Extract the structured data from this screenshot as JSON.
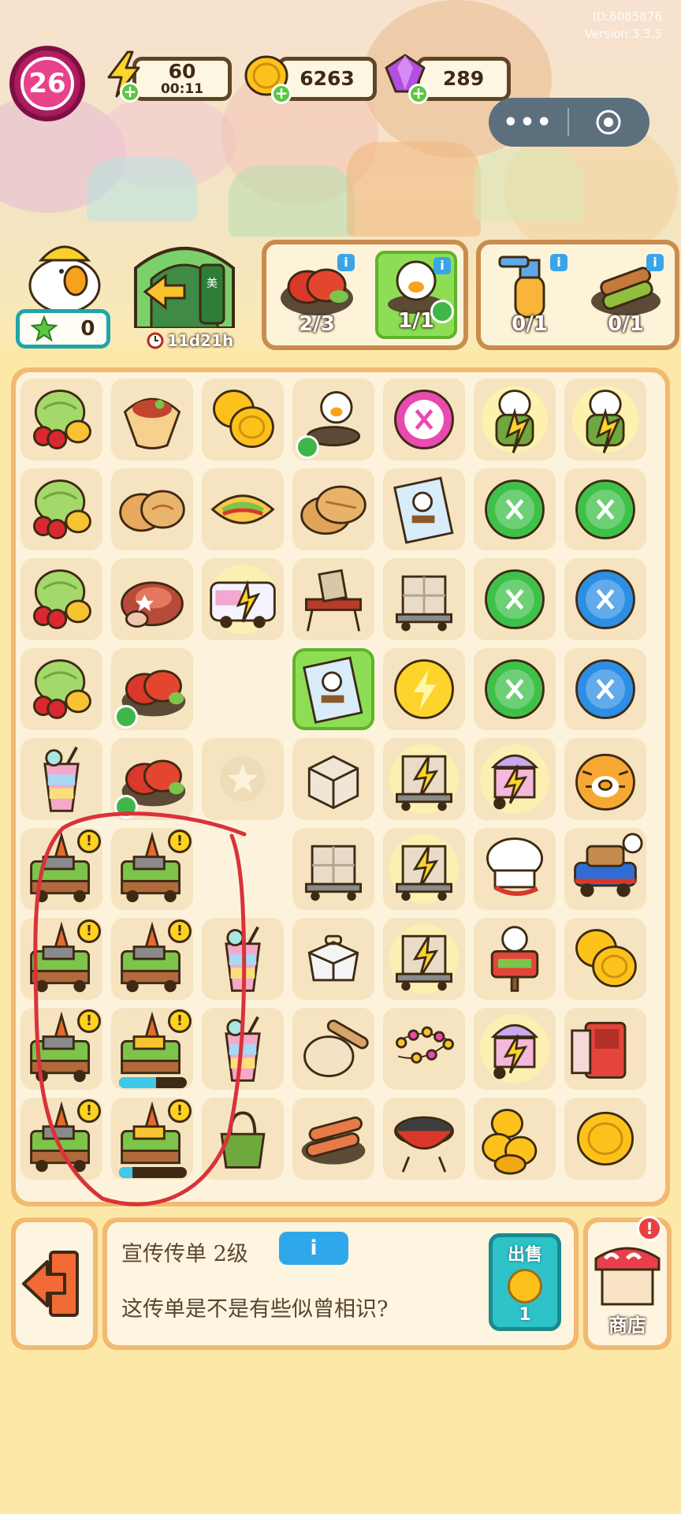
{
  "header": {
    "id_text": "ID:6085876",
    "version_text": "Version:3.3.5",
    "level": "26",
    "energy": {
      "value": "60",
      "timer": "00:11",
      "icon": "lightning-icon"
    },
    "coins": {
      "value": "6263",
      "icon": "coin-icon"
    },
    "gems": {
      "value": "289",
      "icon": "gem-icon"
    },
    "menu": {
      "more": "•••",
      "target_icon": "target-icon"
    }
  },
  "side": {
    "star_count": "0",
    "shop_gate_timer": "11d21h",
    "shop_gate_sign": "美食街"
  },
  "orders": {
    "panel1": [
      {
        "item": "crawfish-plate",
        "count": "2/3",
        "complete": false
      },
      {
        "item": "duck-egg-plate",
        "count": "1/1",
        "complete": true
      }
    ],
    "panel2": [
      {
        "item": "spray-bottle",
        "count": "0/1",
        "complete": false
      },
      {
        "item": "skewer-plate",
        "count": "0/1",
        "complete": false
      }
    ]
  },
  "board": {
    "columns": 7,
    "rows": 9,
    "items": [
      [
        "melon-cherry",
        "burrito",
        "gold-coins",
        "fried-egg-pan",
        "scissors-pink",
        "duck-figure-lit",
        "duck-figure-lit"
      ],
      [
        "melon-cherry",
        "stuffed-buns",
        "omelette-wrap",
        "flatbread",
        "flyer-card",
        "scissors-green",
        "scissors-green"
      ],
      [
        "melon-cherry",
        "roast-meat",
        "food-truck-lit",
        "picnic-table",
        "cart-boxes",
        "scissors-green",
        "scissors-blue"
      ],
      [
        "melon-cherry",
        "crawfish-plate",
        "empty",
        "flyer-card-selected",
        "energy-coin",
        "scissors-green",
        "scissors-blue"
      ],
      [
        "rainbow-drink",
        "crawfish-plate",
        "star-slot",
        "cardboard-box",
        "cart-boxes-lit",
        "ice-cream-cart-lit",
        "tiger-plush"
      ],
      [
        "grill-cart",
        "grill-cart",
        "empty",
        "cart-boxes",
        "cart-boxes-lit",
        "chef-hat",
        "blue-truck"
      ],
      [
        "grill-cart",
        "grill-cart",
        "rainbow-drink",
        "takeout-box",
        "cart-boxes-lit",
        "duck-sign",
        "gold-coins"
      ],
      [
        "grill-cart",
        "grill-cart-loading",
        "rainbow-drink",
        "dough-roller",
        "fairy-lights",
        "ice-cream-cart-lit",
        "red-fridge"
      ],
      [
        "grill-cart",
        "grill-cart-loading",
        "green-bag",
        "grilled-skewers",
        "bbq-grill",
        "coin-stack",
        "gold-coin"
      ]
    ],
    "checked_cells": [
      "0-3",
      "3-1",
      "4-1"
    ],
    "loading_progress": [
      0.55,
      0.2
    ]
  },
  "footer": {
    "exit_icon": "exit-door-icon",
    "item_name": "宣传传单 2级",
    "info_label": "i",
    "item_desc": "这传单是不是有些似曾相识?",
    "sell_label": "出售",
    "sell_price": "1",
    "shop_label": "商店",
    "shop_badge": "!"
  },
  "colors": {
    "board_border": "#f2b970",
    "board_bg": "#fdf3dc",
    "tile": "#f6e3c0",
    "selected": "#8dde55",
    "scribble": "#d9323a"
  }
}
